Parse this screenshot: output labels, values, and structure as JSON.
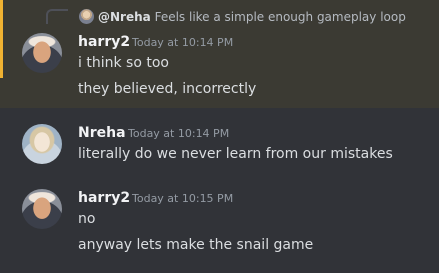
{
  "reply": {
    "author": "@Nreha",
    "text": "Feels like a simple enough gameplay loop"
  },
  "messages": [
    {
      "author": "harry2",
      "timestamp": "Today at 10:14 PM",
      "lines": [
        "i think so too",
        "they believed, incorrectly"
      ],
      "avatar": "harry2-avatar"
    },
    {
      "author": "Nreha",
      "timestamp": "Today at 10:14 PM",
      "lines": [
        "literally do we never learn from our mistakes"
      ],
      "avatar": "nreha-avatar"
    },
    {
      "author": "harry2",
      "timestamp": "Today at 10:15 PM",
      "lines": [
        "no",
        "anyway lets make the snail game"
      ],
      "avatar": "harry2-avatar"
    }
  ],
  "colors": {
    "background": "#313338",
    "mention_highlight": "#3b3a33",
    "mention_bar": "#f0b232"
  }
}
